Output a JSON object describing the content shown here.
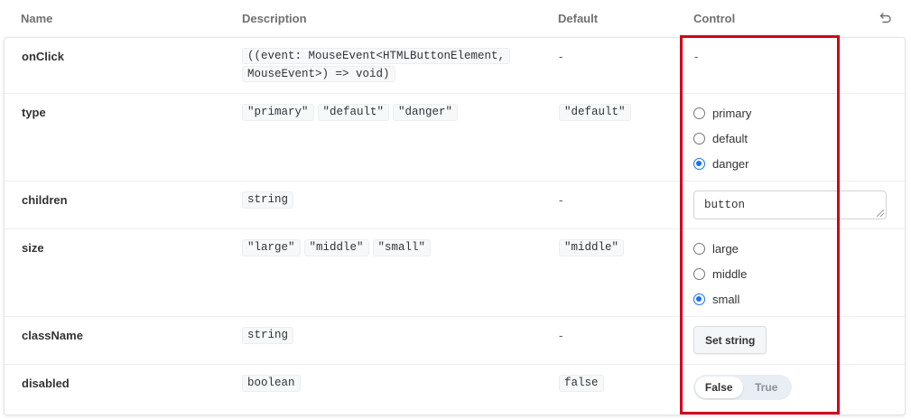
{
  "header": {
    "col_name": "Name",
    "col_description": "Description",
    "col_default": "Default",
    "col_control": "Control"
  },
  "rows": {
    "onclick": {
      "name": "onClick",
      "desc_line1": "((event: MouseEvent<HTMLButtonElement,",
      "desc_line2": "MouseEvent>) => void)",
      "default": "-",
      "control": "-"
    },
    "type": {
      "name": "type",
      "desc": [
        "\"primary\"",
        "\"default\"",
        "\"danger\""
      ],
      "default": "\"default\"",
      "options": [
        "primary",
        "default",
        "danger"
      ],
      "selected": "danger"
    },
    "children": {
      "name": "children",
      "desc": "string",
      "default": "-",
      "value": "button"
    },
    "size": {
      "name": "size",
      "desc": [
        "\"large\"",
        "\"middle\"",
        "\"small\""
      ],
      "default": "\"middle\"",
      "options": [
        "large",
        "middle",
        "small"
      ],
      "selected": "small"
    },
    "classname": {
      "name": "className",
      "desc": "string",
      "default": "-",
      "button": "Set string"
    },
    "disabled": {
      "name": "disabled",
      "desc": "boolean",
      "default": "false",
      "toggle_false": "False",
      "toggle_true": "True",
      "value": "False"
    }
  },
  "colors": {
    "accent": "#1a73e8",
    "highlight_border": "#d0021b"
  }
}
